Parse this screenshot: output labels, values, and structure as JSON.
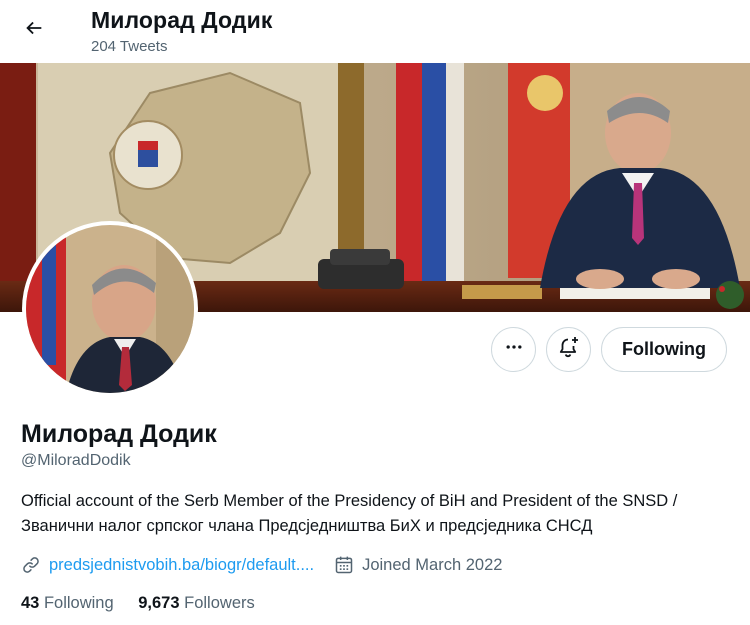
{
  "header": {
    "title": "Милорад Додик",
    "tweet_count": "204 Tweets"
  },
  "icons": {
    "back": "arrow-left-icon",
    "more": "more-dots-icon",
    "notify": "bell-plus-icon",
    "link": "link-icon",
    "calendar": "calendar-icon"
  },
  "actions": {
    "follow_label": "Following"
  },
  "profile": {
    "name": "Милорад Додик",
    "handle": "@MiloradDodik",
    "bio": "Official account of the Serb Member of the Presidency of BiH and President of the SNSD / Званични налог српског члана Предсједништва БиХ и предсједника СНСД",
    "link_text": "predsjednistvobih.ba/biogr/default....",
    "joined": "Joined March 2022"
  },
  "stats": {
    "following_count": "43",
    "following_label": "Following",
    "followers_count": "9,673",
    "followers_label": "Followers"
  },
  "colors": {
    "link": "#1d9bf0",
    "secondary_text": "#536471",
    "border": "#cfd9de"
  }
}
